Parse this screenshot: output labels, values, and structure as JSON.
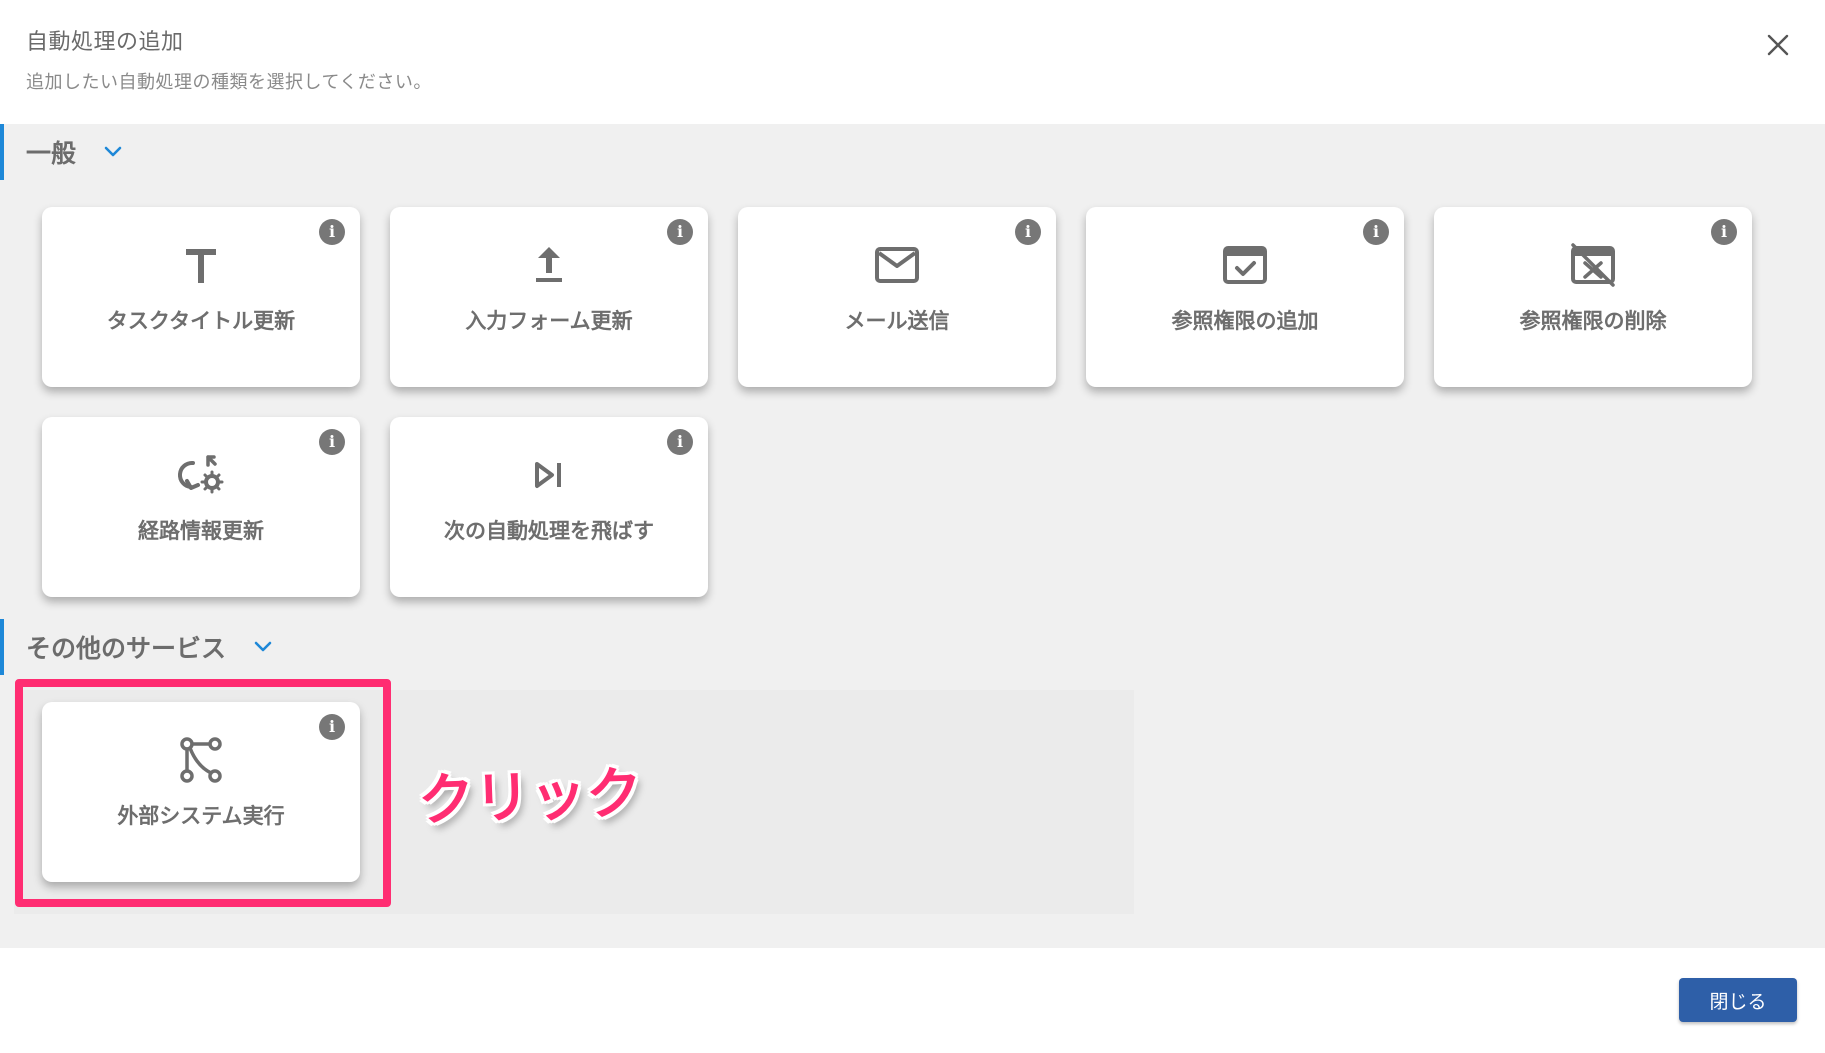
{
  "dialog": {
    "title": "自動処理の追加",
    "subtitle": "追加したい自動処理の種類を選択してください。"
  },
  "sections": {
    "general": {
      "label": "一般"
    },
    "other": {
      "label": "その他のサービス"
    }
  },
  "cards": {
    "task_title": {
      "label": "タスクタイトル更新",
      "icon": "text-t-icon"
    },
    "input_form": {
      "label": "入力フォーム更新",
      "icon": "upload-icon"
    },
    "send_mail": {
      "label": "メール送信",
      "icon": "mail-icon"
    },
    "add_permission": {
      "label": "参照権限の追加",
      "icon": "window-check-icon"
    },
    "remove_permission": {
      "label": "参照権限の削除",
      "icon": "window-off-icon"
    },
    "route_info": {
      "label": "経路情報更新",
      "icon": "refresh-gear-icon"
    },
    "skip_next": {
      "label": "次の自動処理を飛ばす",
      "icon": "skip-next-icon"
    },
    "external_system": {
      "label": "外部システム実行",
      "icon": "flow-nodes-icon"
    }
  },
  "info_glyph": "i",
  "annotation": {
    "text": "クリック"
  },
  "footer": {
    "close_label": "閉じる"
  },
  "colors": {
    "accent": "#1e88d8",
    "highlight": "#ff2d72",
    "primary_button": "#2e5fa8",
    "panel_bg": "#f0f0f0"
  }
}
